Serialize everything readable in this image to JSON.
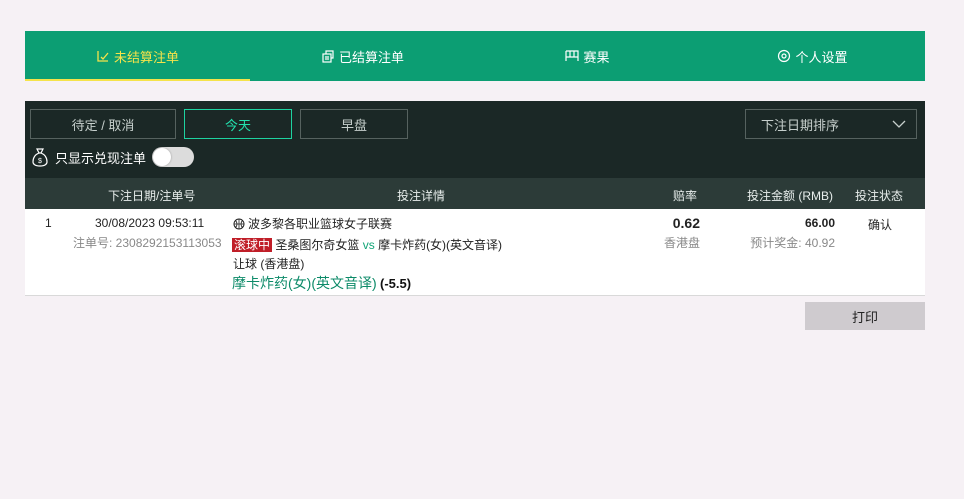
{
  "tabs": [
    {
      "label": "未结算注单",
      "icon": "open-bets-icon"
    },
    {
      "label": "已结算注单",
      "icon": "settled-bets-icon"
    },
    {
      "label": "赛果",
      "icon": "results-icon"
    },
    {
      "label": "个人设置",
      "icon": "settings-icon"
    }
  ],
  "filters": {
    "pending": "待定 / 取消",
    "today": "今天",
    "early": "早盘",
    "sort": "下注日期排序",
    "cashout_label": "只显示兑现注单"
  },
  "colors": {
    "brand_green": "#0c9e73",
    "active_yellow": "#f5e34a",
    "dark_panel": "#1b2826",
    "live_red": "#c01e28"
  },
  "table": {
    "headers": {
      "date": "下注日期/注单号",
      "details": "投注详情",
      "odds": "赔率",
      "stake": "投注金额 (RMB)",
      "status": "投注状态"
    },
    "rows": [
      {
        "index": "1",
        "datetime": "30/08/2023 09:53:11",
        "bet_no": "注单号: 2308292153113053",
        "league": "波多黎各职业篮球女子联赛",
        "live_tag": "滚球中",
        "home": "圣桑图尔奇女篮",
        "vs": "vs",
        "away": "摩卡炸药(女)(英文音译)",
        "market": "让球 (香港盘)",
        "selection": "摩卡炸药(女)(英文音译)",
        "handicap": "(-5.5)",
        "odds": "0.62",
        "odds_type": "香港盘",
        "stake": "66.00",
        "payout": "预计奖金: 40.92",
        "status": "确认"
      }
    ]
  },
  "print_label": "打印"
}
